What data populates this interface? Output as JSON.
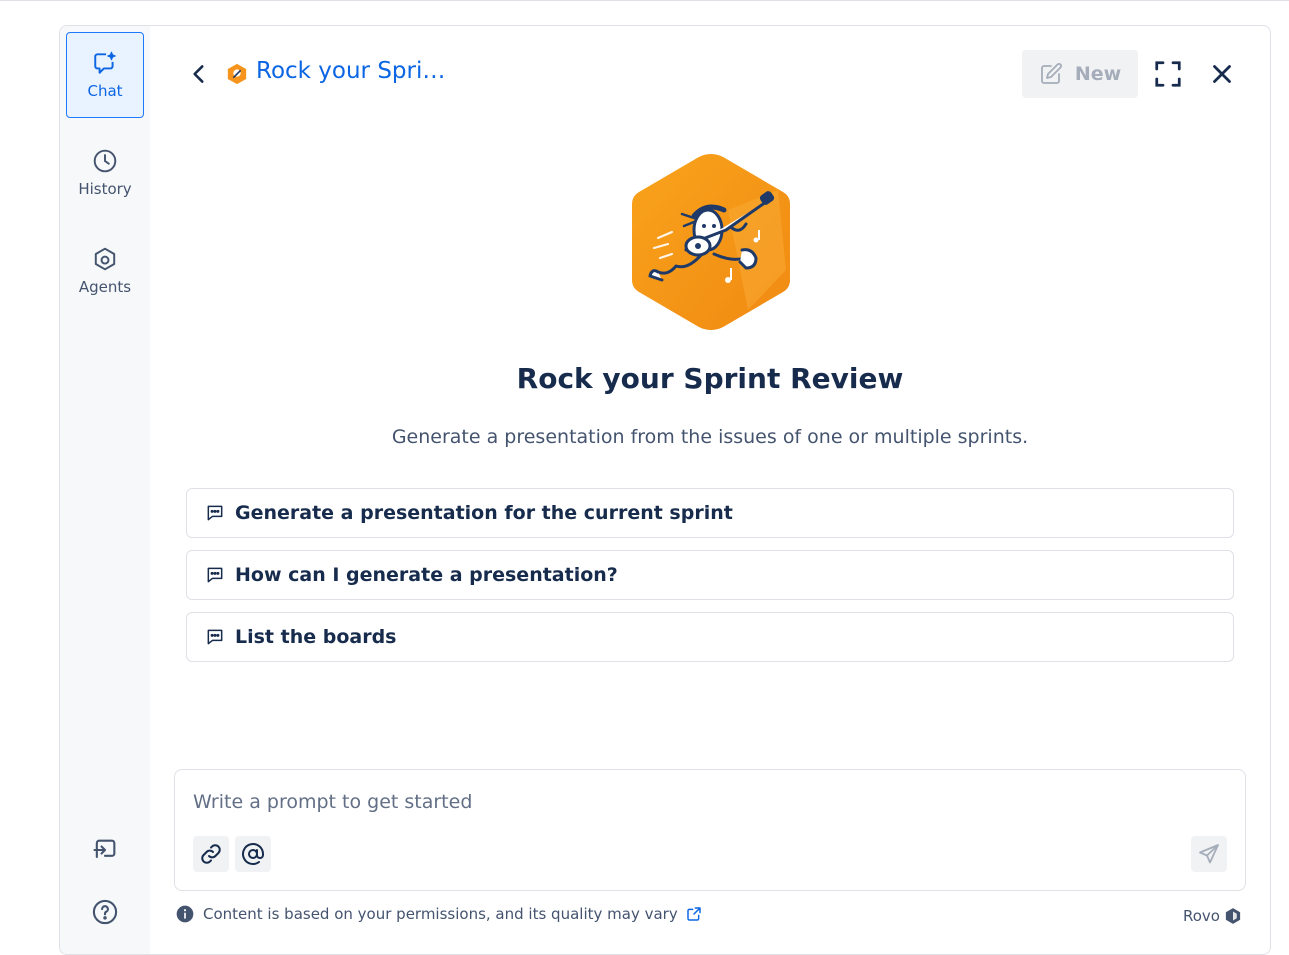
{
  "rail": {
    "chat_label": "Chat",
    "history_label": "History",
    "agents_label": "Agents"
  },
  "header": {
    "title": "Rock your Spri…",
    "new_label": "New"
  },
  "agent": {
    "name": "Rock your Sprint Review",
    "description": "Generate a presentation from the issues of one or multiple sprints."
  },
  "suggestions": [
    "Generate a presentation for the current sprint",
    "How can I generate a presentation?",
    "List the boards"
  ],
  "prompt": {
    "placeholder": "Write a prompt to get started"
  },
  "footer": {
    "disclaimer": "Content is based on your permissions, and its quality may vary",
    "brand": "Rovo"
  },
  "colors": {
    "accent": "#0c66e4",
    "hero_orange": "#f7941d"
  }
}
